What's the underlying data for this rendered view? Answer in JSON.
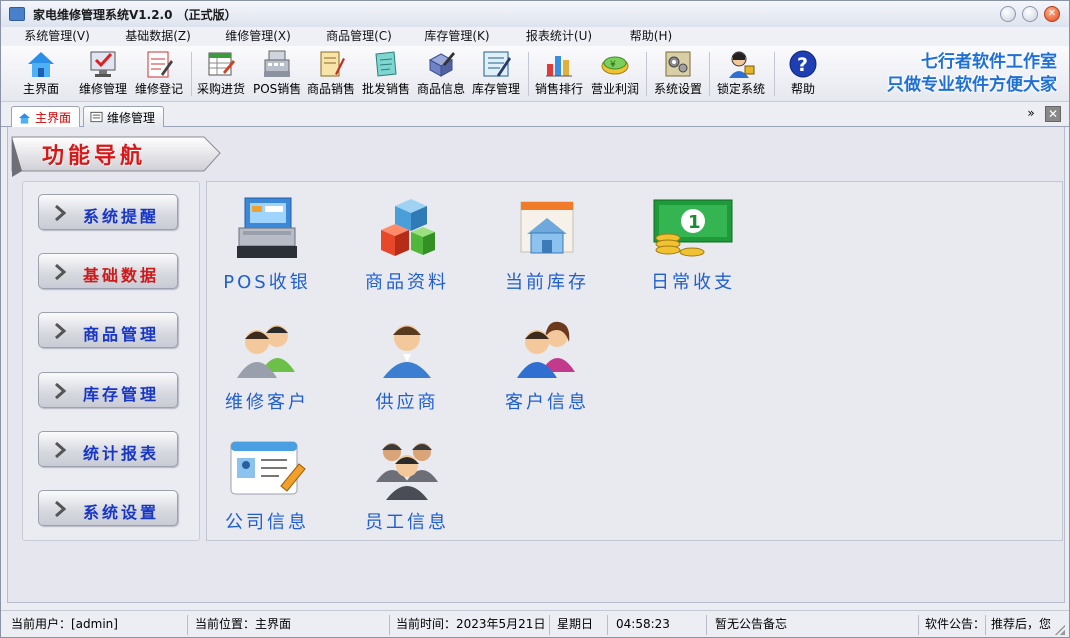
{
  "window": {
    "title": "家电维修管理系统V1.2.0 （正式版）"
  },
  "menu": [
    "系统管理(V)",
    "基础数据(Z)",
    "维修管理(X)",
    "商品管理(C)",
    "库存管理(K)",
    "报表统计(U)",
    "帮助(H)"
  ],
  "toolbar": {
    "items": [
      {
        "label": "主界面",
        "icon": "home-icon"
      },
      {
        "label": "维修管理",
        "icon": "repair-check-icon"
      },
      {
        "label": "维修登记",
        "icon": "register-icon"
      },
      {
        "label": "采购进货",
        "icon": "purchase-icon"
      },
      {
        "label": "POS销售",
        "icon": "pos-icon"
      },
      {
        "label": "商品销售",
        "icon": "sales-icon"
      },
      {
        "label": "批发销售",
        "icon": "wholesale-icon"
      },
      {
        "label": "商品信息",
        "icon": "goods-info-icon"
      },
      {
        "label": "库存管理",
        "icon": "inventory-icon"
      },
      {
        "label": "销售排行",
        "icon": "bar-chart-icon"
      },
      {
        "label": "营业利润",
        "icon": "profit-icon"
      },
      {
        "label": "系统设置",
        "icon": "settings-icon"
      },
      {
        "label": "锁定系统",
        "icon": "lock-user-icon"
      },
      {
        "label": "帮助",
        "icon": "help-icon"
      }
    ],
    "ad_line1": "七行者软件工作室",
    "ad_line2": "只做专业软件方便大家"
  },
  "tabs": [
    {
      "label": "主界面",
      "icon": "home-icon"
    },
    {
      "label": "维修管理",
      "icon": "form-icon"
    }
  ],
  "nav": {
    "title": "功能导航",
    "buttons": [
      "系统提醒",
      "基础数据",
      "商品管理",
      "库存管理",
      "统计报表",
      "系统设置"
    ]
  },
  "functions": [
    {
      "label": "POS收银",
      "icon": "cash-register-icon"
    },
    {
      "label": "商品资料",
      "icon": "cubes-icon"
    },
    {
      "label": "当前库存",
      "icon": "warehouse-icon"
    },
    {
      "label": "日常收支",
      "icon": "money-icon"
    },
    {
      "label": "维修客户",
      "icon": "customers-icon"
    },
    {
      "label": "供应商",
      "icon": "supplier-icon"
    },
    {
      "label": "客户信息",
      "icon": "client-info-icon"
    },
    {
      "label": "公司信息",
      "icon": "company-card-icon"
    },
    {
      "label": "员工信息",
      "icon": "staff-icon"
    }
  ],
  "status": {
    "user": "当前用户：[admin]",
    "location": "当前位置：主界面",
    "time": "当前时间：2023年5月21日",
    "weekday": "星期日",
    "clock": "04:58:23",
    "memo": "暂无公告备忘",
    "notice_label": "软件公告：",
    "notice": "推荐后，您"
  }
}
